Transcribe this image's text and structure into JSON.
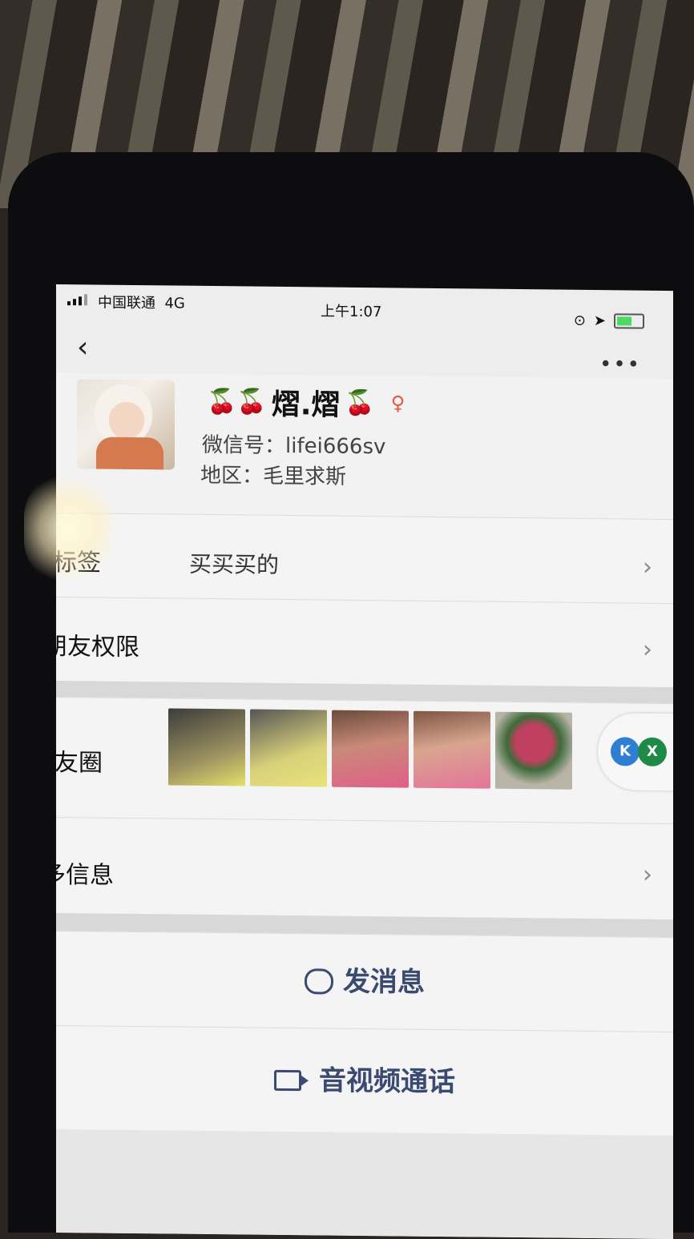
{
  "status_bar": {
    "carrier": "中国联通",
    "network": "4G",
    "time": "上午1:07"
  },
  "nav": {
    "back_glyph": "‹",
    "more_glyph": "•••"
  },
  "profile": {
    "name": "熠.熠",
    "name_decoration": "🍒🍒",
    "name_suffix_decoration": "🍒",
    "wechat_id": "微信号：lifei666sv",
    "region": "地区：毛里求斯"
  },
  "rows": {
    "tag_label": "标签",
    "tag_value": "买买买的",
    "permissions_label": "朋友权限",
    "moments_label": "朋友圈",
    "more_info_label": "更多信息"
  },
  "float_buttons": {
    "k_label": "K",
    "x_label": "X"
  },
  "actions": {
    "message_label": "发消息",
    "call_label": "音视频通话"
  },
  "colors": {
    "accent": "#3a4a70",
    "background": "#ededed"
  }
}
